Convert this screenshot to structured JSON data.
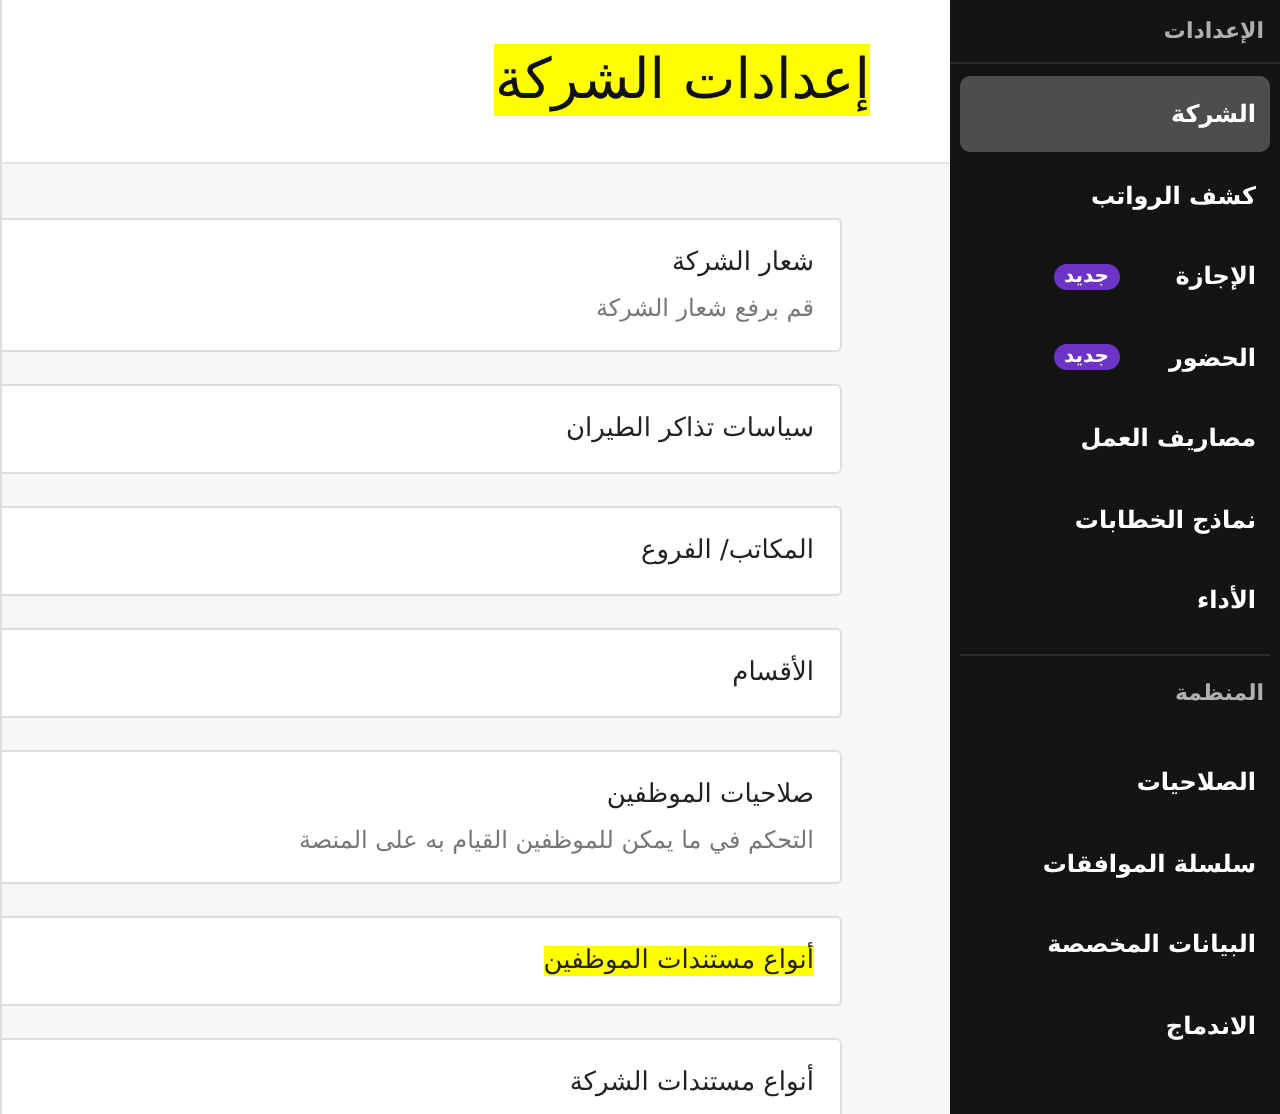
{
  "page": {
    "title": "إعدادات الشركة",
    "title_highlighted": true
  },
  "cards": [
    {
      "title": "شعار الشركة",
      "description": "قم برفع شعار الشركة",
      "highlighted": false
    },
    {
      "title": "سياسات تذاكر الطيران",
      "highlighted": false
    },
    {
      "title": "المكاتب/ الفروع",
      "highlighted": false
    },
    {
      "title": "الأقسام",
      "highlighted": false
    },
    {
      "title": "صلاحيات الموظفين",
      "description": "التحكم في ما يمكن للموظفين القيام به على المنصة",
      "highlighted": false
    },
    {
      "title": "أنواع مستندات الموظفين",
      "highlighted": true
    },
    {
      "title": "أنواع مستندات الشركة",
      "highlighted": false
    }
  ],
  "sidebar": {
    "sections": [
      {
        "heading": "الإعدادات",
        "items": [
          {
            "label": "الشركة",
            "selected": true
          },
          {
            "label": "كشف الرواتب",
            "selected": false
          },
          {
            "label": "الإجازة",
            "selected": false,
            "badge": "جديد"
          },
          {
            "label": "الحضور",
            "selected": false,
            "badge": "جديد"
          },
          {
            "label": "مصاريف العمل",
            "selected": false
          },
          {
            "label": "نماذج الخطابات",
            "selected": false
          },
          {
            "label": "الأداء",
            "selected": false
          }
        ]
      },
      {
        "heading": "المنظمة",
        "items": [
          {
            "label": "الصلاحيات",
            "selected": false
          },
          {
            "label": "سلسلة الموافقات",
            "selected": false
          },
          {
            "label": "البيانات المخصصة",
            "selected": false
          },
          {
            "label": "الاندماج",
            "selected": false
          }
        ]
      }
    ]
  }
}
